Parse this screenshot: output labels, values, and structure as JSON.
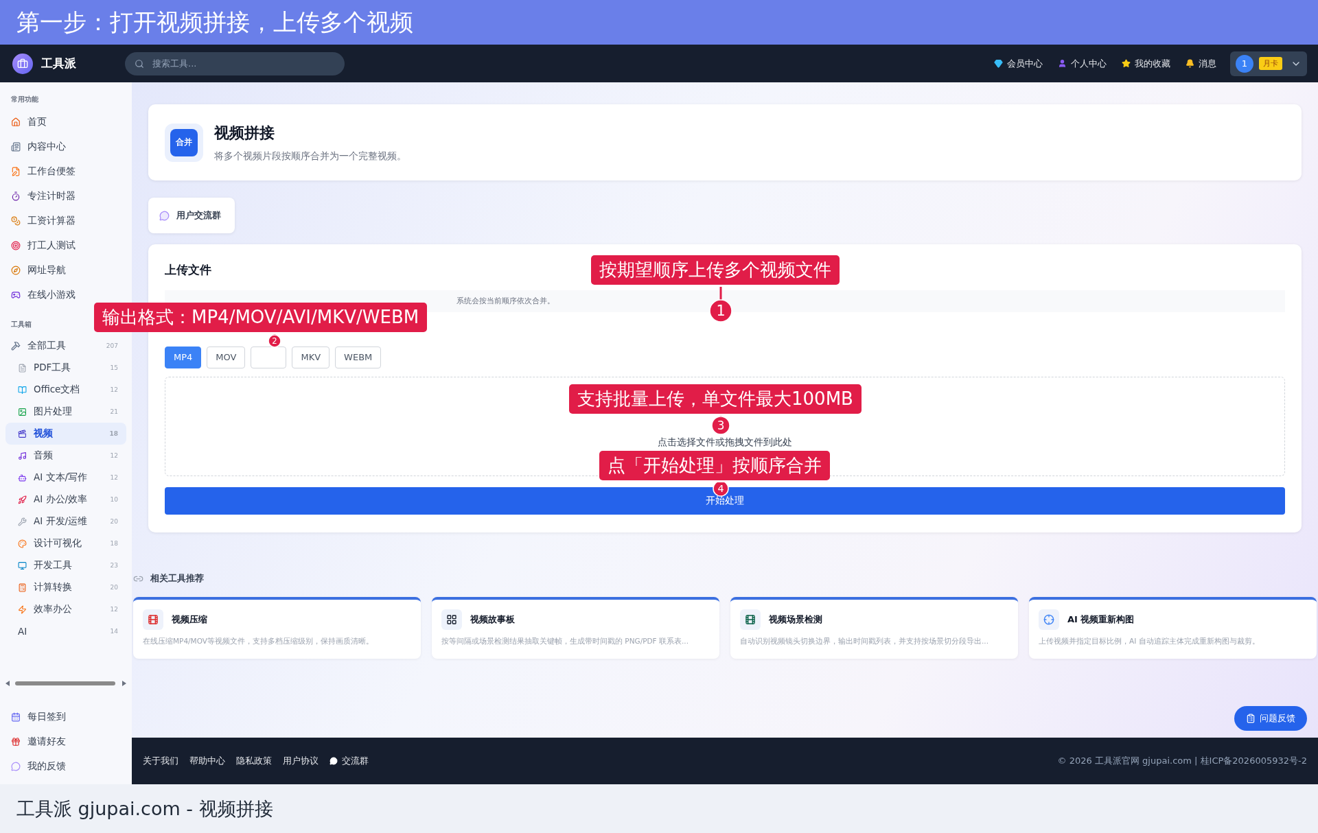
{
  "banner": {
    "title": "第一步：打开视频拼接，上传多个视频"
  },
  "navbar": {
    "logo_text": "工具派",
    "search": {
      "placeholder": "搜索工具..."
    },
    "links": [
      {
        "label": "会员中心"
      },
      {
        "label": "个人中心"
      },
      {
        "label": "我的收藏"
      },
      {
        "label": "消息"
      }
    ],
    "user": {
      "badge": "1",
      "plan": "月卡"
    }
  },
  "sidebar": {
    "common_title": "常用功能",
    "common_items": [
      {
        "label": "首页"
      },
      {
        "label": "内容中心"
      },
      {
        "label": "工作台便签"
      },
      {
        "label": "专注计时器"
      },
      {
        "label": "工资计算器"
      },
      {
        "label": "打工人测试"
      },
      {
        "label": "网址导航"
      },
      {
        "label": "在线小游戏"
      }
    ],
    "toolbox_title": "工具箱",
    "all_tools": {
      "label": "全部工具",
      "count": "207"
    },
    "categories": [
      {
        "label": "PDF工具",
        "count": "15",
        "selected": false
      },
      {
        "label": "Office文档",
        "count": "12",
        "selected": false
      },
      {
        "label": "图片处理",
        "count": "21",
        "selected": false
      },
      {
        "label": "视频",
        "count": "18",
        "selected": true
      },
      {
        "label": "音频",
        "count": "12",
        "selected": false
      },
      {
        "label": "AI 文本/写作",
        "count": "12",
        "selected": false
      },
      {
        "label": "AI 办公/效率",
        "count": "10",
        "selected": false
      },
      {
        "label": "AI 开发/运维",
        "count": "20",
        "selected": false
      },
      {
        "label": "设计可视化",
        "count": "18",
        "selected": false
      },
      {
        "label": "开发工具",
        "count": "23",
        "selected": false
      },
      {
        "label": "计算转换",
        "count": "20",
        "selected": false
      },
      {
        "label": "效率办公",
        "count": "12",
        "selected": false
      },
      {
        "label": "AI",
        "count": "14",
        "selected": false
      }
    ],
    "bottom_items": [
      {
        "label": "每日签到"
      },
      {
        "label": "邀请好友"
      },
      {
        "label": "我的反馈"
      }
    ]
  },
  "tool": {
    "icon_text": "合并",
    "title": "视频拼接",
    "description": "将多个视频片段按顺序合并为一个完整视频。"
  },
  "community_button": "用户交流群",
  "upload": {
    "title": "上传文件",
    "hint": "系统会按当前顺序依次合并。",
    "formats": [
      {
        "label": "MP4",
        "selected": true
      },
      {
        "label": "MOV",
        "selected": false
      },
      {
        "selected": false
      },
      {
        "label": "MKV",
        "selected": false
      },
      {
        "label": "WEBM",
        "selected": false
      }
    ],
    "dropzone_text": "点击选择文件或拖拽文件到此处",
    "start_button": "开始处理"
  },
  "related": {
    "title": "相关工具推荐",
    "tools": [
      {
        "name": "视频压缩",
        "description": "在线压缩MP4/MOV等视频文件，支持多档压缩级别，保持画质清晰。"
      },
      {
        "name": "视频故事板",
        "description": "按等间隔或场景检测结果抽取关键帧，生成带时间戳的 PNG/PDF 联系表..."
      },
      {
        "name": "视频场景检测",
        "description": "自动识别视频镜头切换边界，输出时间戳列表，并支持按场景切分段导出..."
      },
      {
        "name": "AI 视频重新构图",
        "description": "上传视频并指定目标比例，AI 自动追踪主体完成重新构图与裁剪。"
      }
    ]
  },
  "feedback_button": "问题反馈",
  "footer": {
    "links": [
      {
        "label": "关于我们"
      },
      {
        "label": "帮助中心"
      },
      {
        "label": "隐私政策"
      },
      {
        "label": "用户协议"
      },
      {
        "label": "交流群"
      }
    ],
    "copyright": "© 2026 工具派官网 gjupai.com | 桂ICP备2026005932号-2"
  },
  "caption": "工具派 gjupai.com - 视频拼接",
  "annotations": [
    {
      "number": "1",
      "text": "按期望顺序上传多个视频文件"
    },
    {
      "number": "2",
      "text": "输出格式：MP4/MOV/AVI/MKV/WEBM"
    },
    {
      "number": "3",
      "text": "支持批量上传，单文件最大100MB"
    },
    {
      "number": "4",
      "text": "点「开始处理」按顺序合并"
    }
  ]
}
